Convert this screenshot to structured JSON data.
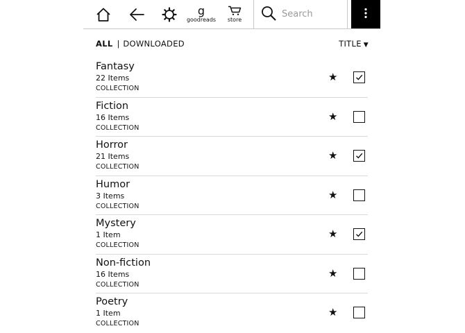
{
  "toolbar": {
    "home_icon": "home-icon",
    "back_icon": "back-arrow-icon",
    "settings_icon": "gear-icon",
    "goodreads_glyph": "g",
    "goodreads_label": "goodreads",
    "store_icon": "cart-icon",
    "store_label": "store",
    "search_icon": "search-icon",
    "search_placeholder": "Search",
    "menu_icon": "vertical-dots-icon"
  },
  "filters": {
    "all_label": "ALL",
    "separator": "|",
    "downloaded_label": "DOWNLOADED",
    "sort_label": "TITLE",
    "sort_caret": "▼"
  },
  "collections": [
    {
      "title": "Fantasy",
      "count": "22 Items",
      "type": "COLLECTION",
      "star": "★",
      "checked": true
    },
    {
      "title": "Fiction",
      "count": "16 Items",
      "type": "COLLECTION",
      "star": "★",
      "checked": false
    },
    {
      "title": "Horror",
      "count": "21 Items",
      "type": "COLLECTION",
      "star": "★",
      "checked": true
    },
    {
      "title": "Humor",
      "count": "3 Items",
      "type": "COLLECTION",
      "star": "★",
      "checked": false
    },
    {
      "title": "Mystery",
      "count": "1 Item",
      "type": "COLLECTION",
      "star": "★",
      "checked": true
    },
    {
      "title": "Non-fiction",
      "count": "16 Items",
      "type": "COLLECTION",
      "star": "★",
      "checked": false
    },
    {
      "title": "Poetry",
      "count": "1 Item",
      "type": "COLLECTION",
      "star": "★",
      "checked": false
    }
  ],
  "colors": {
    "menu_bg": "#000000",
    "divider": "#d8d8d8"
  }
}
